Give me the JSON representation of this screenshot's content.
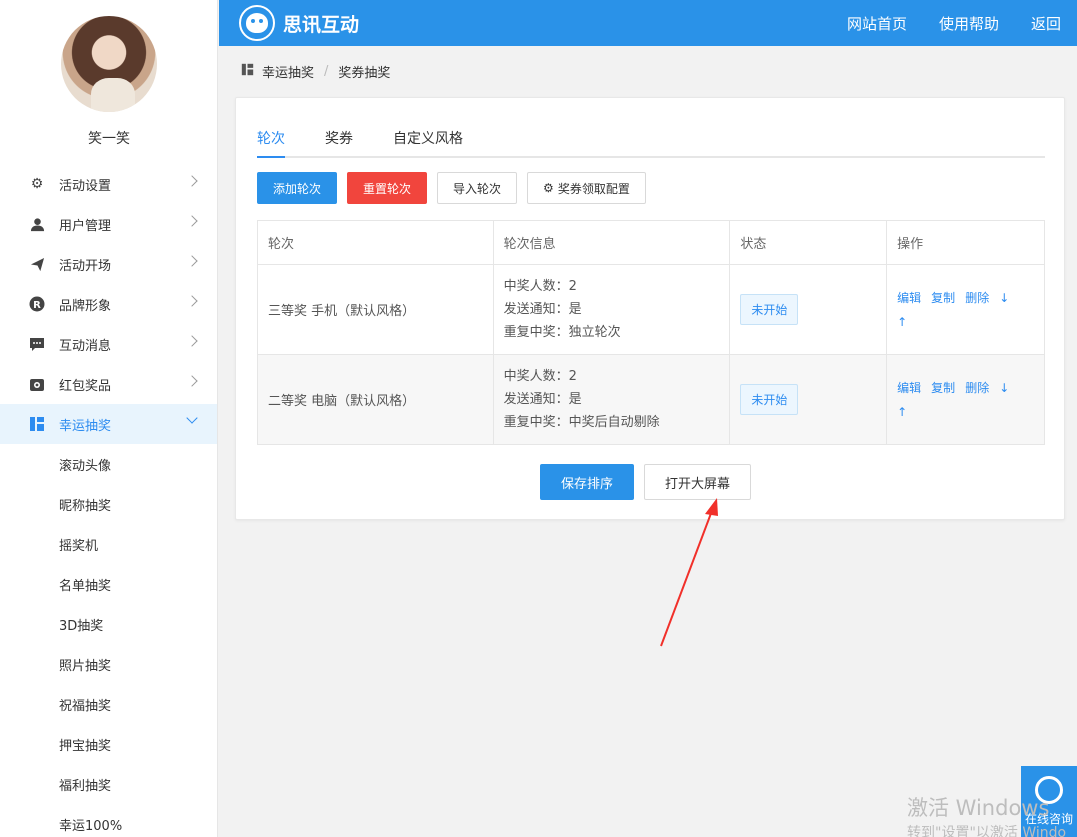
{
  "user": {
    "name": "笑一笑"
  },
  "sidebar": {
    "items": [
      {
        "label": "活动设置",
        "icon": "gear-icon"
      },
      {
        "label": "用户管理",
        "icon": "user-icon"
      },
      {
        "label": "活动开场",
        "icon": "send-icon"
      },
      {
        "label": "品牌形象",
        "icon": "registered-icon"
      },
      {
        "label": "互动消息",
        "icon": "message-icon"
      },
      {
        "label": "红包奖品",
        "icon": "gift-icon"
      },
      {
        "label": "幸运抽奖",
        "icon": "lottery-icon",
        "active": true
      }
    ],
    "sub_items": [
      "滚动头像",
      "昵称抽奖",
      "摇奖机",
      "名单抽奖",
      "3D抽奖",
      "照片抽奖",
      "祝福抽奖",
      "押宝抽奖",
      "福利抽奖",
      "幸运100%"
    ]
  },
  "header": {
    "brand": "思讯互动",
    "nav": [
      "网站首页",
      "使用帮助",
      "返回"
    ],
    "bg_color": "#2a92e8"
  },
  "breadcrumb": {
    "items": [
      "幸运抽奖",
      "奖券抽奖"
    ],
    "separator": "/"
  },
  "tabs": [
    "轮次",
    "奖券",
    "自定义风格"
  ],
  "buttons": {
    "add": "添加轮次",
    "reset": "重置轮次",
    "import": "导入轮次",
    "config": "奖券领取配置",
    "save_order": "保存排序",
    "open_screen": "打开大屏幕"
  },
  "table": {
    "headers": [
      "轮次",
      "轮次信息",
      "状态",
      "操作"
    ],
    "rows": [
      {
        "name": "三等奖 手机（默认风格）",
        "info": [
          "中奖人数：2",
          "发送通知：是",
          "重复中奖：独立轮次"
        ],
        "status": "未开始",
        "ops": [
          "编辑",
          "复制",
          "删除",
          "↓",
          "↑"
        ]
      },
      {
        "name": "二等奖 电脑（默认风格）",
        "info": [
          "中奖人数：2",
          "发送通知：是",
          "重复中奖：中奖后自动剔除"
        ],
        "status": "未开始",
        "ops": [
          "编辑",
          "复制",
          "删除",
          "↓",
          "↑"
        ]
      }
    ]
  },
  "consult": {
    "label": "在线咨询"
  },
  "watermark": {
    "line1": "激活 Windows",
    "line2": "转到\"设置\"以激活 Windo"
  },
  "colors": {
    "primary": "#2a92e8",
    "danger": "#f1453d",
    "active_bg": "#e8f4fd"
  }
}
